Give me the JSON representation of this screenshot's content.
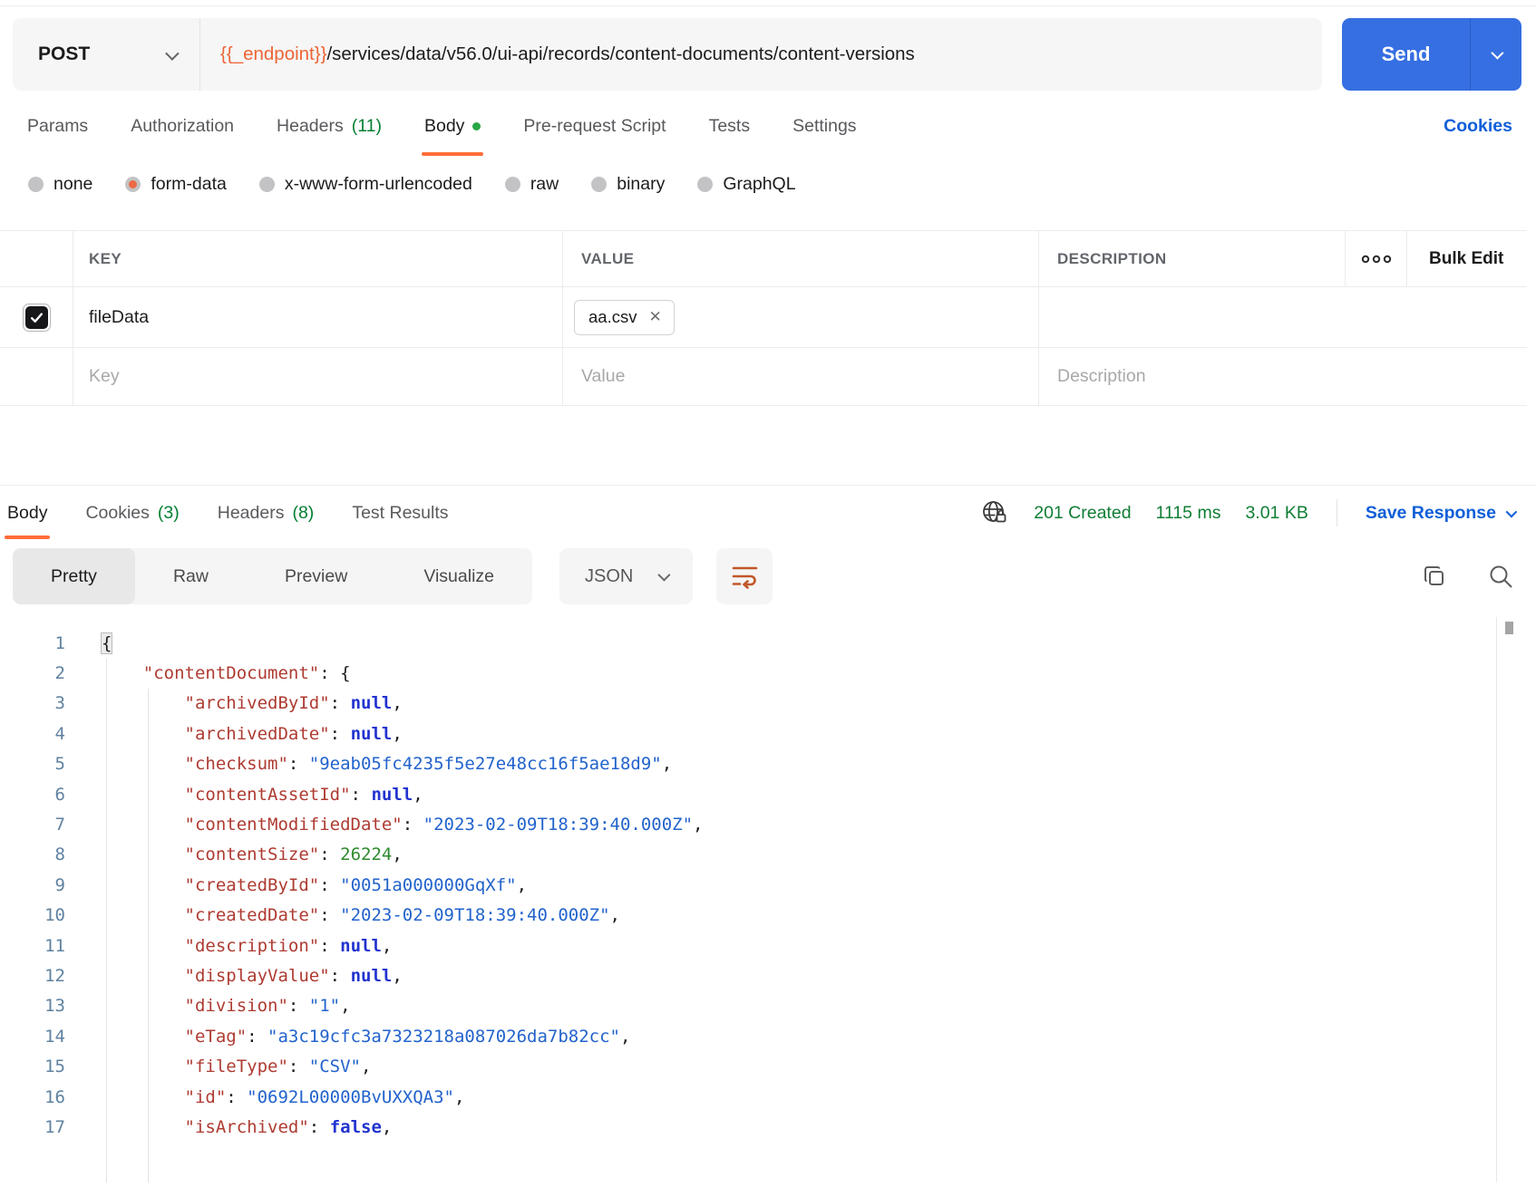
{
  "colors": {
    "accent_orange": "#FF6C37",
    "send_blue": "#356FE2",
    "link_blue": "#105FD8",
    "success_green": "#0F7D33",
    "count_green": "#007F31"
  },
  "request": {
    "method": "POST",
    "url": {
      "variable": "{{_endpoint}}",
      "path": "/services/data/v56.0/ui-api/records/content-documents/content-versions"
    },
    "send_label": "Send",
    "cookies_link": "Cookies",
    "tabs": [
      {
        "label": "Params"
      },
      {
        "label": "Authorization"
      },
      {
        "label": "Headers",
        "count": "(11)"
      },
      {
        "label": "Body",
        "active": true,
        "dot": true
      },
      {
        "label": "Pre-request Script"
      },
      {
        "label": "Tests"
      },
      {
        "label": "Settings"
      }
    ],
    "body_modes": [
      {
        "label": "none"
      },
      {
        "label": "form-data",
        "selected": true
      },
      {
        "label": "x-www-form-urlencoded"
      },
      {
        "label": "raw"
      },
      {
        "label": "binary"
      },
      {
        "label": "GraphQL"
      }
    ],
    "form_table": {
      "headers": {
        "key": "KEY",
        "value": "VALUE",
        "description": "DESCRIPTION"
      },
      "bulk_edit_label": "Bulk Edit",
      "rows": [
        {
          "checked": true,
          "key": "fileData",
          "value_chip": "aa.csv"
        }
      ],
      "placeholders": {
        "key": "Key",
        "value": "Value",
        "description": "Description"
      }
    }
  },
  "response": {
    "tabs": [
      {
        "label": "Body",
        "active": true
      },
      {
        "label": "Cookies",
        "count": "(3)"
      },
      {
        "label": "Headers",
        "count": "(8)"
      },
      {
        "label": "Test Results"
      }
    ],
    "meta": {
      "status": "201 Created",
      "time": "1115 ms",
      "size": "3.01 KB",
      "save_label": "Save Response"
    },
    "view_tabs": [
      {
        "label": "Pretty",
        "active": true
      },
      {
        "label": "Raw"
      },
      {
        "label": "Preview"
      },
      {
        "label": "Visualize"
      }
    ],
    "format_select": "JSON",
    "code": {
      "lines": [
        {
          "n": "1",
          "t": [
            [
              "hl",
              "{"
            ]
          ]
        },
        {
          "n": "2",
          "t": [
            [
              "ws",
              "    "
            ],
            [
              "key",
              "\"contentDocument\""
            ],
            [
              "p",
              ": {"
            ]
          ]
        },
        {
          "n": "3",
          "t": [
            [
              "ws",
              "        "
            ],
            [
              "key",
              "\"archivedById\""
            ],
            [
              "p",
              ": "
            ],
            [
              "kw",
              "null"
            ],
            [
              "p",
              ","
            ]
          ]
        },
        {
          "n": "4",
          "t": [
            [
              "ws",
              "        "
            ],
            [
              "key",
              "\"archivedDate\""
            ],
            [
              "p",
              ": "
            ],
            [
              "kw",
              "null"
            ],
            [
              "p",
              ","
            ]
          ]
        },
        {
          "n": "5",
          "t": [
            [
              "ws",
              "        "
            ],
            [
              "key",
              "\"checksum\""
            ],
            [
              "p",
              ": "
            ],
            [
              "str",
              "\"9eab05fc4235f5e27e48cc16f5ae18d9\""
            ],
            [
              "p",
              ","
            ]
          ]
        },
        {
          "n": "6",
          "t": [
            [
              "ws",
              "        "
            ],
            [
              "key",
              "\"contentAssetId\""
            ],
            [
              "p",
              ": "
            ],
            [
              "kw",
              "null"
            ],
            [
              "p",
              ","
            ]
          ]
        },
        {
          "n": "7",
          "t": [
            [
              "ws",
              "        "
            ],
            [
              "key",
              "\"contentModifiedDate\""
            ],
            [
              "p",
              ": "
            ],
            [
              "str",
              "\"2023-02-09T18:39:40.000Z\""
            ],
            [
              "p",
              ","
            ]
          ]
        },
        {
          "n": "8",
          "t": [
            [
              "ws",
              "        "
            ],
            [
              "key",
              "\"contentSize\""
            ],
            [
              "p",
              ": "
            ],
            [
              "num",
              "26224"
            ],
            [
              "p",
              ","
            ]
          ]
        },
        {
          "n": "9",
          "t": [
            [
              "ws",
              "        "
            ],
            [
              "key",
              "\"createdById\""
            ],
            [
              "p",
              ": "
            ],
            [
              "str",
              "\"0051a000000GqXf\""
            ],
            [
              "p",
              ","
            ]
          ]
        },
        {
          "n": "10",
          "t": [
            [
              "ws",
              "        "
            ],
            [
              "key",
              "\"createdDate\""
            ],
            [
              "p",
              ": "
            ],
            [
              "str",
              "\"2023-02-09T18:39:40.000Z\""
            ],
            [
              "p",
              ","
            ]
          ]
        },
        {
          "n": "11",
          "t": [
            [
              "ws",
              "        "
            ],
            [
              "key",
              "\"description\""
            ],
            [
              "p",
              ": "
            ],
            [
              "kw",
              "null"
            ],
            [
              "p",
              ","
            ]
          ]
        },
        {
          "n": "12",
          "t": [
            [
              "ws",
              "        "
            ],
            [
              "key",
              "\"displayValue\""
            ],
            [
              "p",
              ": "
            ],
            [
              "kw",
              "null"
            ],
            [
              "p",
              ","
            ]
          ]
        },
        {
          "n": "13",
          "t": [
            [
              "ws",
              "        "
            ],
            [
              "key",
              "\"division\""
            ],
            [
              "p",
              ": "
            ],
            [
              "str",
              "\"1\""
            ],
            [
              "p",
              ","
            ]
          ]
        },
        {
          "n": "14",
          "t": [
            [
              "ws",
              "        "
            ],
            [
              "key",
              "\"eTag\""
            ],
            [
              "p",
              ": "
            ],
            [
              "str",
              "\"a3c19cfc3a7323218a087026da7b82cc\""
            ],
            [
              "p",
              ","
            ]
          ]
        },
        {
          "n": "15",
          "t": [
            [
              "ws",
              "        "
            ],
            [
              "key",
              "\"fileType\""
            ],
            [
              "p",
              ": "
            ],
            [
              "str",
              "\"CSV\""
            ],
            [
              "p",
              ","
            ]
          ]
        },
        {
          "n": "16",
          "t": [
            [
              "ws",
              "        "
            ],
            [
              "key",
              "\"id\""
            ],
            [
              "p",
              ": "
            ],
            [
              "str",
              "\"0692L00000BvUXXQA3\""
            ],
            [
              "p",
              ","
            ]
          ]
        },
        {
          "n": "17",
          "t": [
            [
              "ws",
              "        "
            ],
            [
              "key",
              "\"isArchived\""
            ],
            [
              "p",
              ": "
            ],
            [
              "kw",
              "false"
            ],
            [
              "p",
              ","
            ]
          ]
        }
      ]
    }
  }
}
